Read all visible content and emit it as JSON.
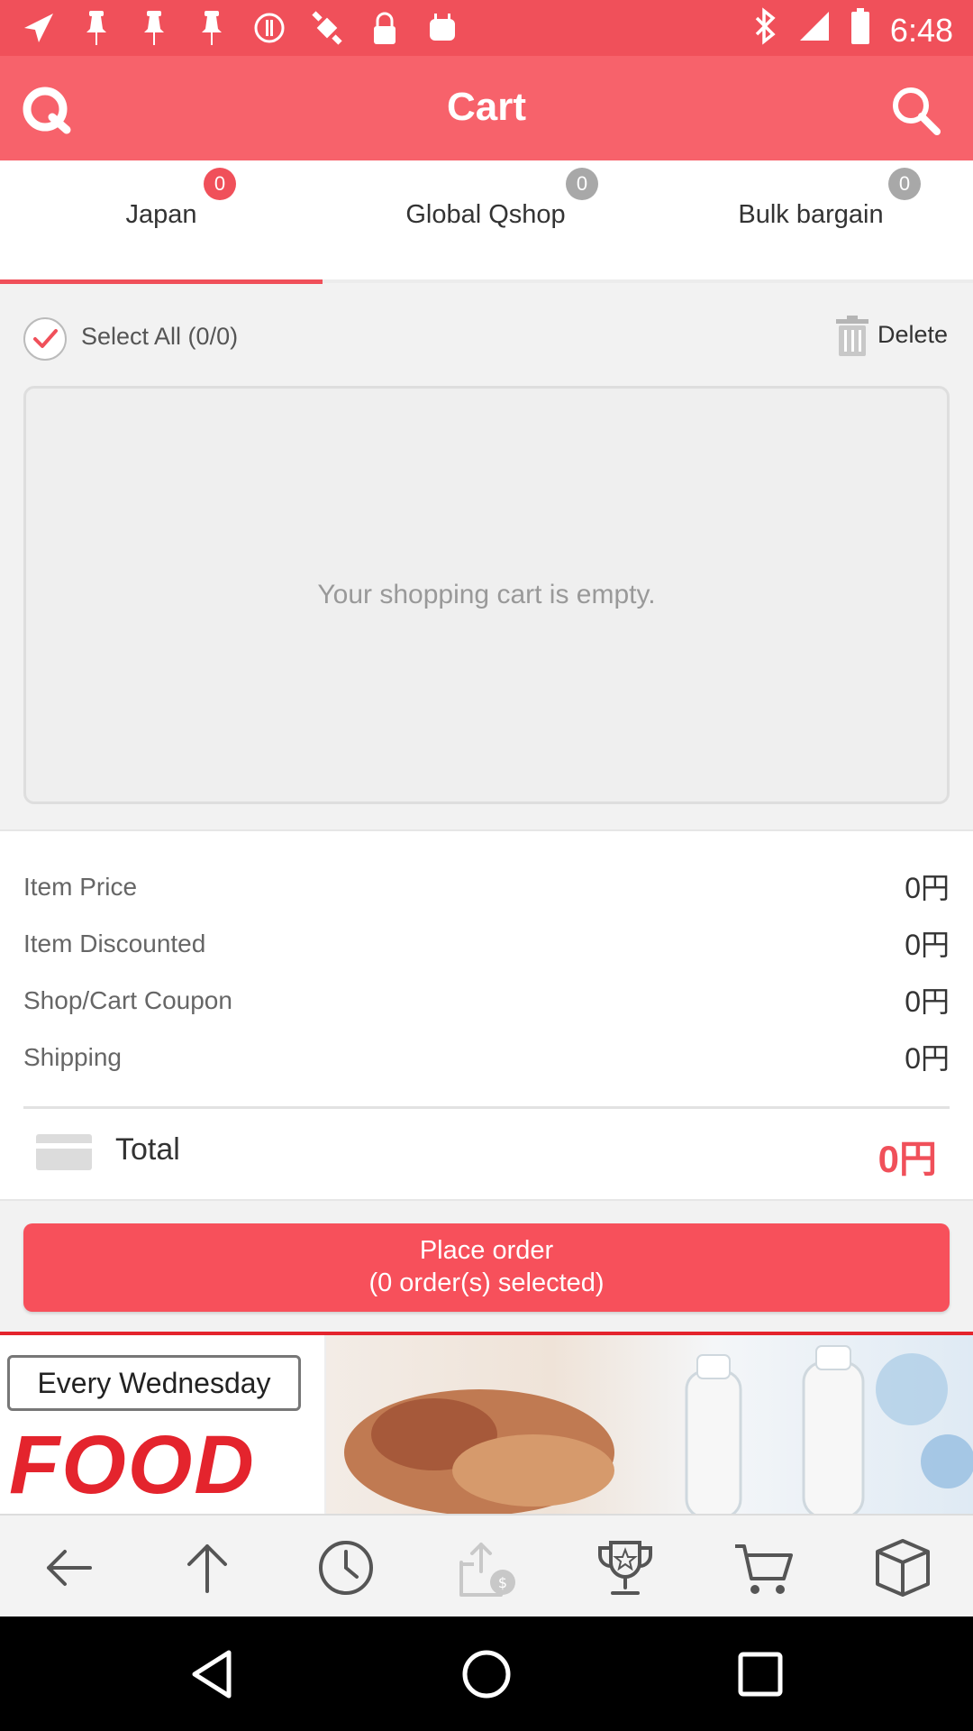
{
  "status_bar": {
    "time": "6:48",
    "left_icons": [
      "send-icon",
      "pin-icon",
      "pin-icon",
      "pin-icon",
      "alert-icon",
      "satellite-off-icon",
      "lock-icon",
      "android-icon"
    ],
    "right_icons": [
      "bluetooth-icon",
      "signal-icon",
      "battery-icon"
    ]
  },
  "app_bar": {
    "title": "Cart",
    "brand_color": "#f7626b"
  },
  "tabs": [
    {
      "label": "Japan",
      "count": "0",
      "badge_color": "#f0505a",
      "active": true
    },
    {
      "label": "Global Qshop",
      "count": "0",
      "badge_color": "#a8a8a8",
      "active": false
    },
    {
      "label": "Bulk bargain",
      "count": "0",
      "badge_color": "#a8a8a8",
      "active": false
    }
  ],
  "select_row": {
    "select_all_label": "Select All (0/0)",
    "delete_label": "Delete"
  },
  "cart": {
    "empty_message": "Your shopping cart is empty."
  },
  "summary": {
    "rows": [
      {
        "label": "Item Price",
        "value": "0円"
      },
      {
        "label": "Item Discounted",
        "value": "0円"
      },
      {
        "label": "Shop/Cart Coupon",
        "value": "0円"
      },
      {
        "label": "Shipping",
        "value": "0円"
      }
    ],
    "total_label": "Total",
    "total_value": "0円"
  },
  "place_order": {
    "line1": "Place order",
    "line2": "(0 order(s) selected)"
  },
  "banner": {
    "tag": "Every Wednesday",
    "headline": "FOOD"
  },
  "bottom_nav": [
    "back-arrow-icon",
    "scroll-up-icon",
    "history-clock-icon",
    "sell-icon",
    "trophy-icon",
    "cart-icon",
    "box-icon"
  ],
  "system_nav": [
    "back-triangle-icon",
    "home-circle-icon",
    "recents-square-icon"
  ]
}
